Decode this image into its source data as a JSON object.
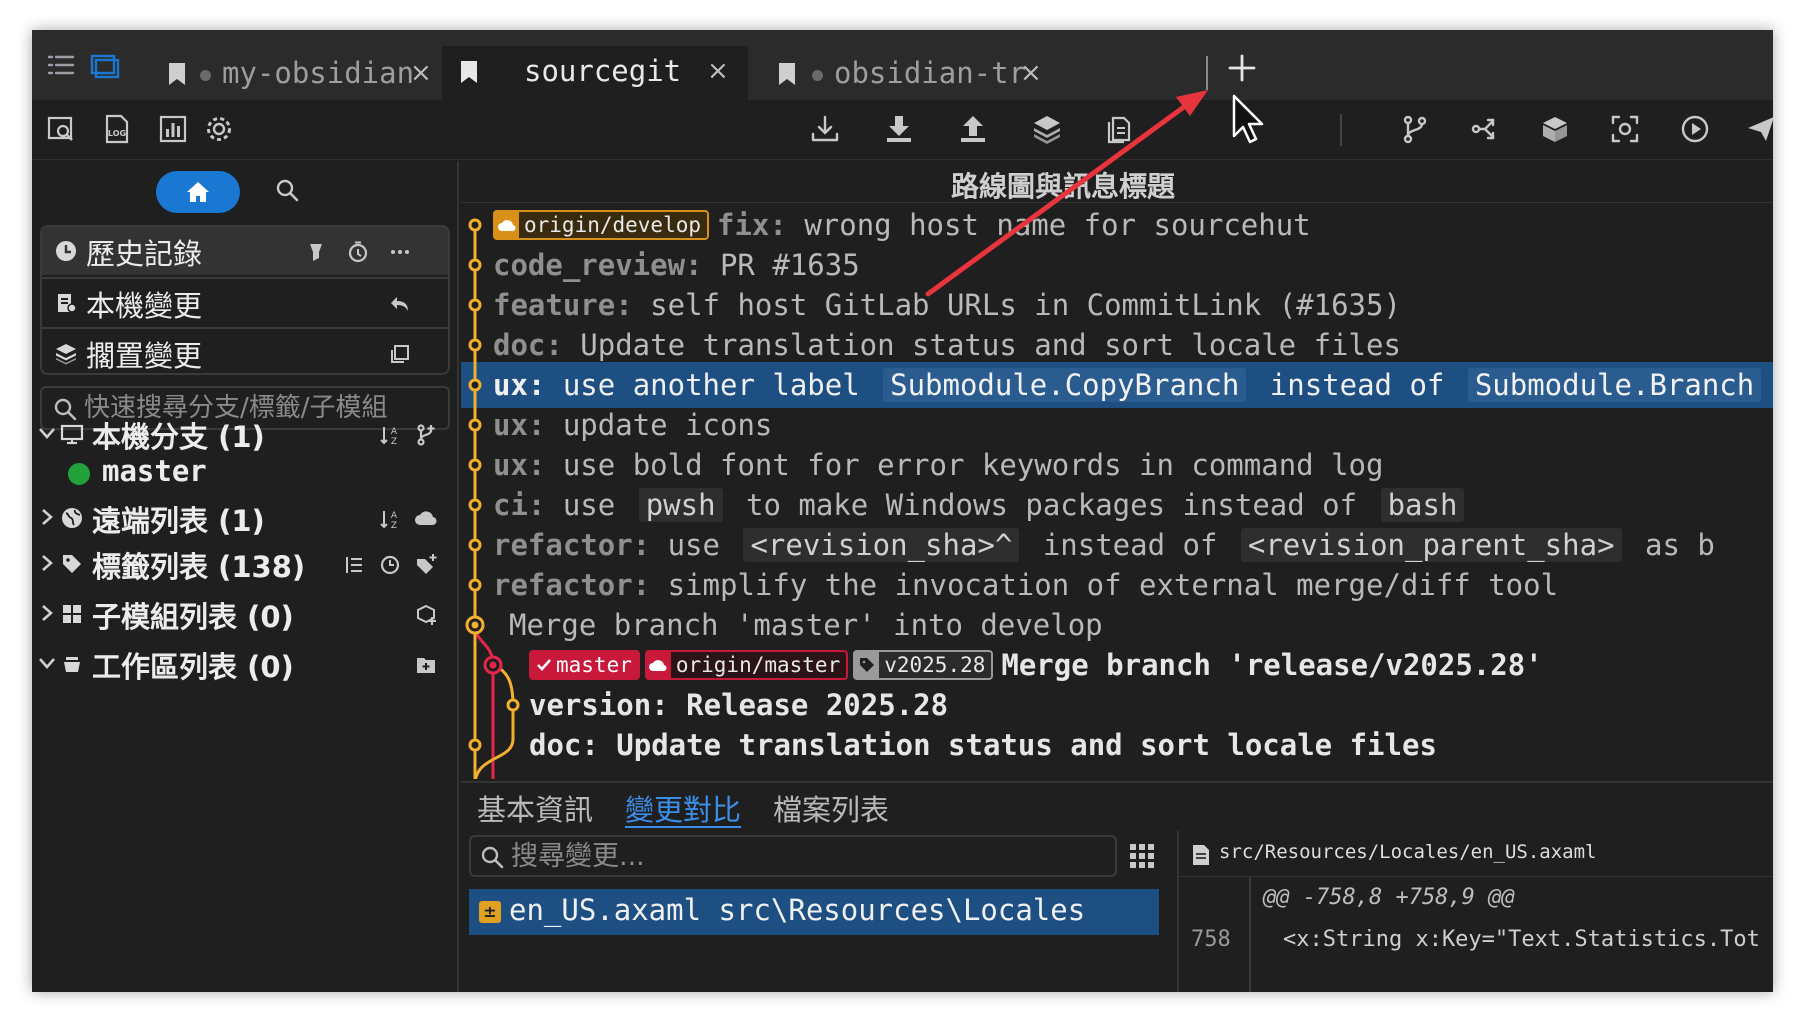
{
  "tabs": [
    {
      "label": "my-obsidian",
      "active": false
    },
    {
      "label": "sourcegit",
      "active": true
    },
    {
      "label": "obsidian-tr",
      "active": false
    }
  ],
  "icons": {
    "tabbar_left": [
      "list-icon",
      "workspace-icon"
    ],
    "tab": "bookmark-icon",
    "tab_close": "×",
    "new_tab": "plus-icon",
    "toolbar_left": [
      "browse-icon",
      "log-icon",
      "statistics-icon",
      "gear-icon"
    ],
    "toolbar_right": [
      "fetch-icon",
      "pull-icon",
      "push-icon",
      "stash-icon",
      "apply-patch-icon",
      "branch-icon",
      "git-flow-icon",
      "lfs-icon",
      "bisect-icon",
      "custom-action-icon",
      "send-icon"
    ]
  },
  "sidebar": {
    "views": [
      {
        "label": "歷史記錄",
        "icon": "history-icon",
        "actions": [
          "highlight-icon",
          "timer-icon",
          "more-icon"
        ]
      },
      {
        "label": "本機變更",
        "icon": "local-changes-icon",
        "actions": [
          "undo-icon"
        ]
      },
      {
        "label": "擱置變更",
        "icon": "stashes-icon",
        "actions": [
          "copy-icon"
        ]
      }
    ],
    "filter_placeholder": "快速搜尋分支/標籤/子模組",
    "tree": [
      {
        "label": "本機分支 (1)",
        "icon": "monitor-icon",
        "expanded": true,
        "actions": [
          "sort-icon",
          "new-branch-icon"
        ]
      },
      {
        "label": "遠端列表 (1)",
        "icon": "globe-icon",
        "expanded": false,
        "actions": [
          "sort-icon",
          "add-remote-icon"
        ]
      },
      {
        "label": "標籤列表 (138)",
        "icon": "tag-icon",
        "expanded": false,
        "actions": [
          "tree-view-icon",
          "sort-time-icon",
          "new-tag-icon"
        ]
      },
      {
        "label": "子模組列表 (0)",
        "icon": "grid-icon",
        "expanded": false,
        "actions": [
          "add-submodule-icon"
        ]
      },
      {
        "label": "工作區列表 (0)",
        "icon": "worktree-icon",
        "expanded": true,
        "actions": [
          "add-worktree-icon"
        ]
      }
    ],
    "local_branch": "master"
  },
  "graph": {
    "header": "路線圖與訊息標題",
    "commits": [
      {
        "badges": [
          {
            "kind": "remote-dev",
            "icon": "cloud",
            "label": "origin/develop"
          }
        ],
        "type": "fix:",
        "parts": [
          {
            "t": " wrong host name for sourcehut"
          }
        ]
      },
      {
        "type": "code_review:",
        "parts": [
          {
            "t": " PR #1635"
          }
        ]
      },
      {
        "type": "feature:",
        "parts": [
          {
            "t": " self host GitLab URLs in CommitLink (#1635)"
          }
        ]
      },
      {
        "type": "doc:",
        "parts": [
          {
            "t": " Update translation status and sort locale files"
          }
        ]
      },
      {
        "type": "ux:",
        "selected": true,
        "parts": [
          {
            "t": " use another label "
          },
          {
            "c": "Submodule.CopyBranch"
          },
          {
            "t": " instead of "
          },
          {
            "c": "Submodule.Branch"
          }
        ]
      },
      {
        "type": "ux:",
        "parts": [
          {
            "t": " update icons"
          }
        ]
      },
      {
        "type": "ux:",
        "parts": [
          {
            "t": " use bold font for error keywords in command log"
          }
        ]
      },
      {
        "type": "ci:",
        "parts": [
          {
            "t": " use "
          },
          {
            "c": "pwsh"
          },
          {
            "t": " to make Windows packages instead of "
          },
          {
            "c": "bash"
          }
        ]
      },
      {
        "type": "refactor:",
        "parts": [
          {
            "t": " use "
          },
          {
            "c": "<revision_sha>^"
          },
          {
            "t": " instead of "
          },
          {
            "c": "<revision_parent_sha>"
          },
          {
            "t": " as b"
          }
        ]
      },
      {
        "type": "refactor:",
        "parts": [
          {
            "t": " simplify the invocation of external merge/diff tool"
          }
        ]
      },
      {
        "type": "",
        "merge": true,
        "parts": [
          {
            "t": "Merge branch 'master' into develop"
          }
        ]
      },
      {
        "badges": [
          {
            "kind": "local",
            "icon": "check",
            "label": "master"
          },
          {
            "kind": "remote-m",
            "icon": "cloud",
            "label": "origin/master"
          },
          {
            "kind": "tag",
            "icon": "tag",
            "label": "v2025.28"
          }
        ],
        "type": "",
        "head": true,
        "parts": [
          {
            "t": "Merge branch 'release/v2025.28'"
          }
        ]
      },
      {
        "type": "version:",
        "head": true,
        "parts": [
          {
            "t": " Release 2025.28"
          }
        ]
      },
      {
        "type": "doc:",
        "head": true,
        "parts": [
          {
            "t": " Update translation status and sort locale files"
          }
        ]
      }
    ],
    "lane_colors": [
      "#f2b02c",
      "#e8244a"
    ]
  },
  "detail": {
    "tabs": [
      {
        "label": "基本資訊",
        "active": false
      },
      {
        "label": "變更對比",
        "active": true
      },
      {
        "label": "檔案列表",
        "active": false
      }
    ],
    "search_placeholder": "搜尋變更...",
    "change": {
      "status": "±",
      "file": "en_US.axaml",
      "path": "src\\Resources\\Locales"
    },
    "diff": {
      "file": "src/Resources/Locales/en_US.axaml",
      "hunk": "@@ -758,8 +758,9 @@",
      "line_no": "758",
      "line": "<x:String x:Key=\"Text.Statistics.Tot"
    }
  },
  "colors": {
    "accent": "#1a78d2",
    "selection": "#1d4f82",
    "annotation": "#e8343c"
  }
}
